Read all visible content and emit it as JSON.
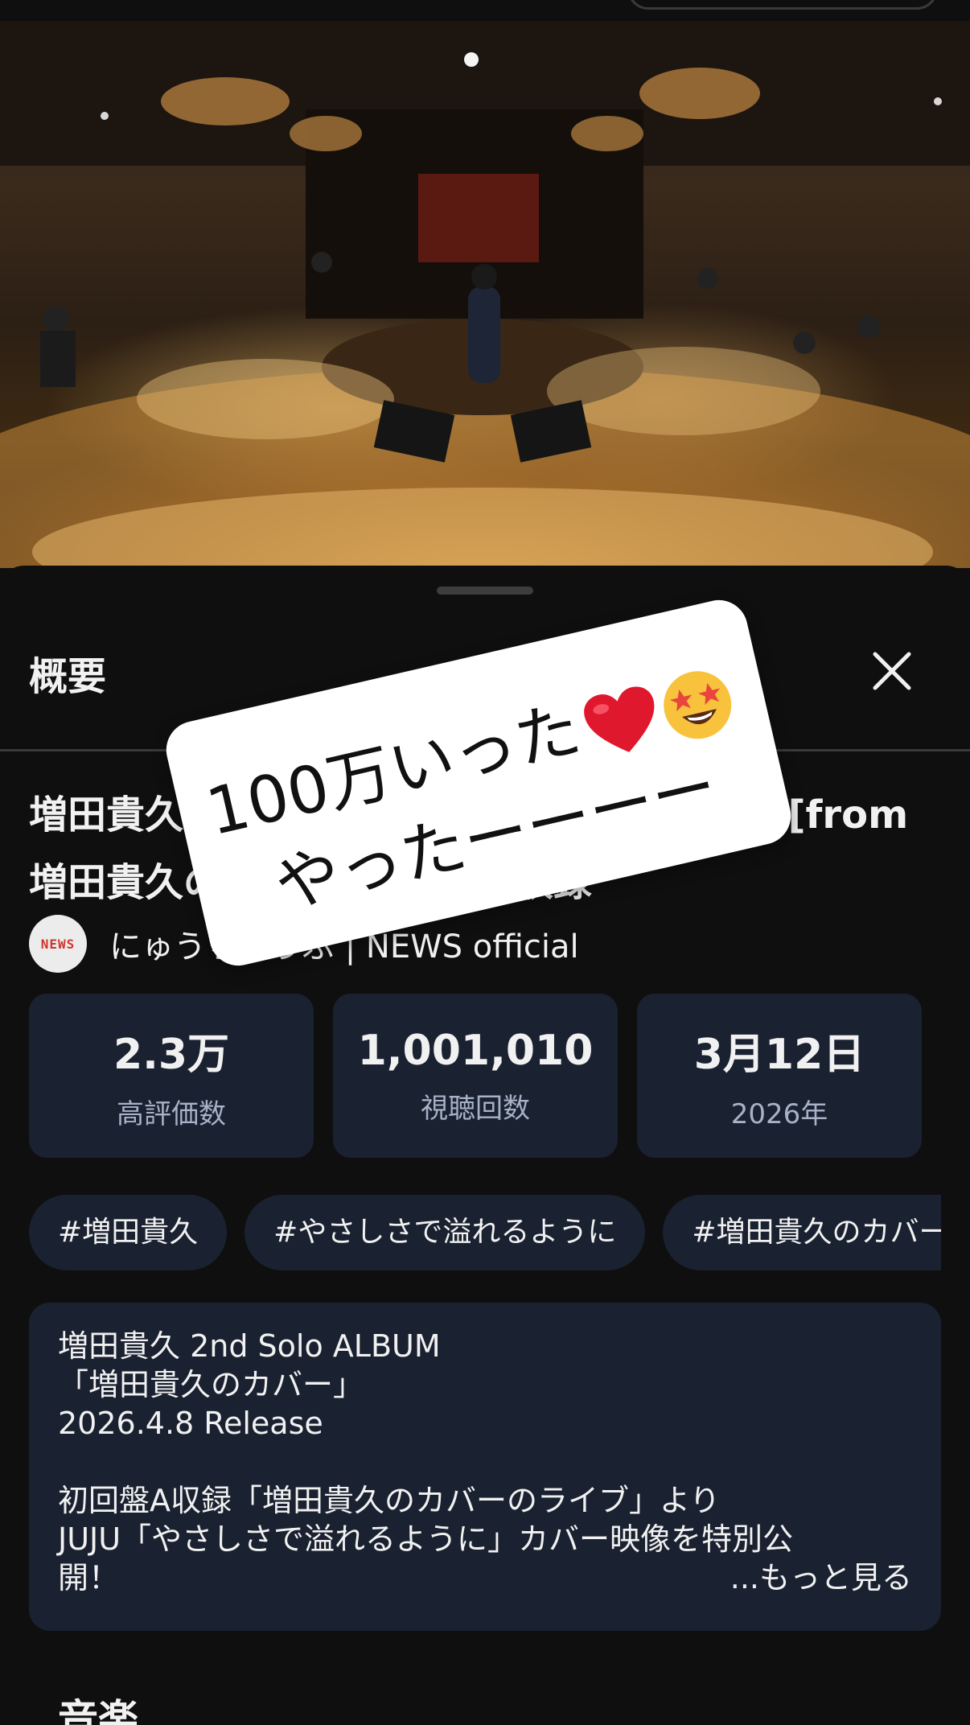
{
  "sheet": {
    "title": "概要"
  },
  "video": {
    "title": "増田貴久「やさしさで溢れるように」Live [from 増田貴久のカバー] 初回盤A収録",
    "channel_name": "にゅうちゅうぶ | NEWS official",
    "avatar_text": "NEWS"
  },
  "stats": [
    {
      "value": "2.3万",
      "label": "高評価数"
    },
    {
      "value": "1,001,010",
      "label": "視聴回数"
    },
    {
      "value": "3月12日",
      "label": "2026年"
    }
  ],
  "tags": [
    "#増田貴久",
    "#やさしさで溢れるように",
    "#増田貴久のカバー"
  ],
  "description": {
    "text": "増田貴久 2nd Solo ALBUM\n「増田貴久のカバー」\n2026.4.8 Release\n\n初回盤A収録「増田貴久のカバーのライブ」より\nJUJU「やさしさで溢れるように」カバー映像を特別公\n開！",
    "more_label": "...もっと見る"
  },
  "section": {
    "heading": "音楽"
  },
  "overlay": {
    "line1": "100万いった",
    "line2": "やったーーーー"
  },
  "colors": {
    "background": "#0f0f0f",
    "card": "#1a2130",
    "muted_text": "#a7b2c6",
    "heart": "#e0182d",
    "emoji_face": "#f9c23c"
  },
  "icons": {
    "close": "close-icon",
    "heart": "heart-icon",
    "star_struck": "star-struck-emoji-icon"
  }
}
